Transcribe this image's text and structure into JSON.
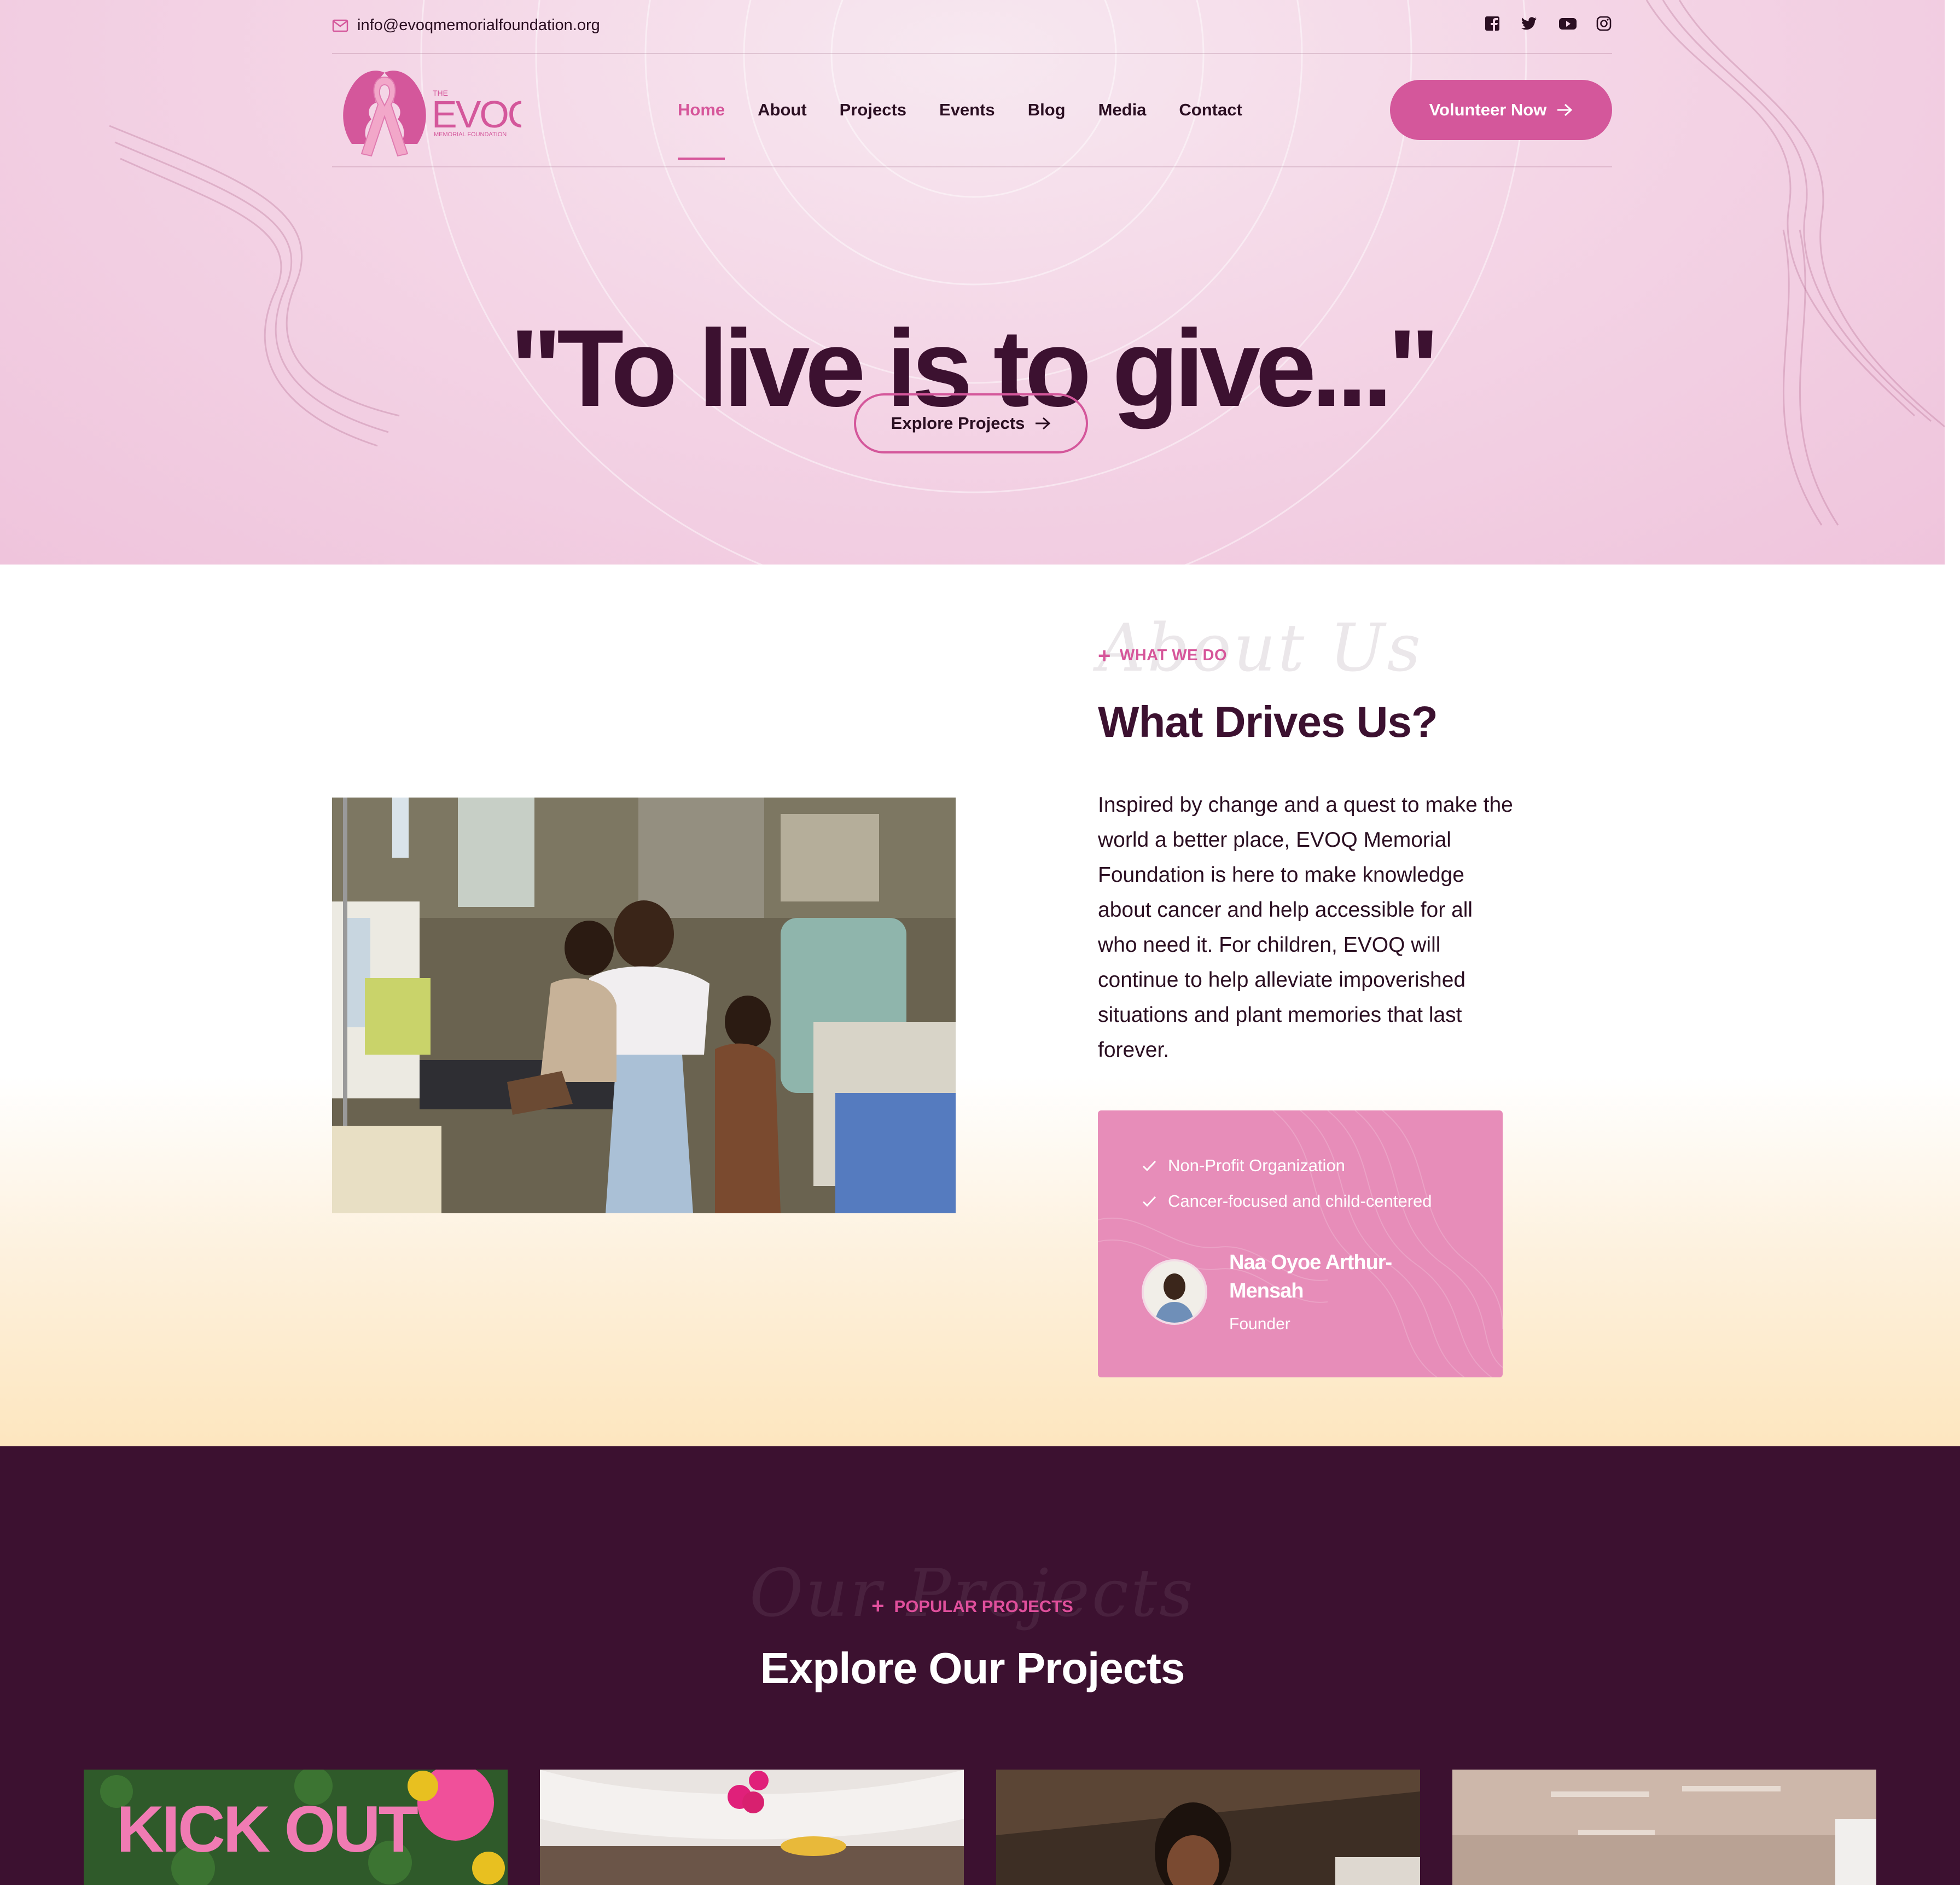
{
  "topbar": {
    "email": "info@evoqmemorialfoundation.org",
    "social_icons": [
      "facebook-icon",
      "twitter-icon",
      "youtube-icon",
      "instagram-icon"
    ]
  },
  "logo": {
    "the": "THE",
    "name": "EVOQ",
    "subtitle": "MEMORIAL FOUNDATION"
  },
  "nav": {
    "items": [
      {
        "label": "Home",
        "active": true
      },
      {
        "label": "About"
      },
      {
        "label": "Projects"
      },
      {
        "label": "Events"
      },
      {
        "label": "Blog"
      },
      {
        "label": "Media"
      },
      {
        "label": "Contact"
      }
    ],
    "cta": "Volunteer Now"
  },
  "hero": {
    "title": "\"To live is to give...\"",
    "button": "Explore Projects"
  },
  "about": {
    "script_heading": "About Us",
    "kicker": "WHAT WE DO",
    "heading": "What Drives Us?",
    "paragraph": "Inspired by change and a quest to make the world a better place, EVOQ Memorial Foundation is here to make knowledge about cancer and help accessible for all who need it. For children, EVOQ will continue to help alleviate impoverished situations and plant memories that last forever.",
    "checks": [
      "Non-Profit Organization",
      "Cancer-focused and child-centered"
    ],
    "founder": {
      "name": "Naa Oyoe Arthur-Mensah",
      "role": "Founder"
    }
  },
  "projects": {
    "script_heading": "Our Projects",
    "kicker": "POPULAR PROJECTS",
    "heading": "Explore Our Projects",
    "card1_sign": "KICK OUT"
  },
  "colors": {
    "brand_pink": "#d4579b",
    "dark_plum": "#3c1130",
    "card_pink": "#e78db9"
  }
}
